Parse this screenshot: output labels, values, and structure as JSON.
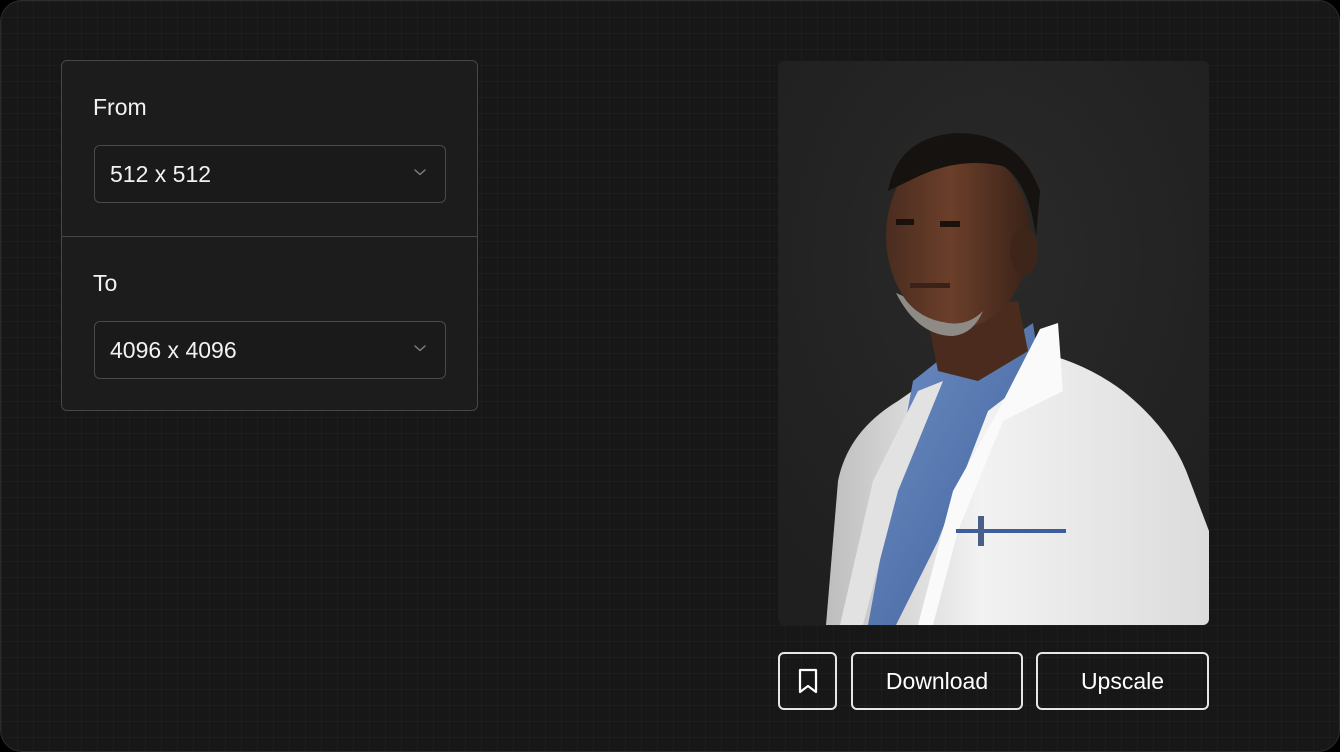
{
  "settings": {
    "from": {
      "label": "From",
      "value": "512 x 512"
    },
    "to": {
      "label": "To",
      "value": "4096 x 4096"
    }
  },
  "preview": {
    "icon": "portrait-image"
  },
  "actions": {
    "bookmark_icon": "bookmark-icon",
    "download_label": "Download",
    "upscale_label": "Upscale"
  },
  "colors": {
    "background": "#171717",
    "panel_border": "#474747",
    "button_border": "#e6e6e6",
    "text": "#f2f2f2"
  }
}
